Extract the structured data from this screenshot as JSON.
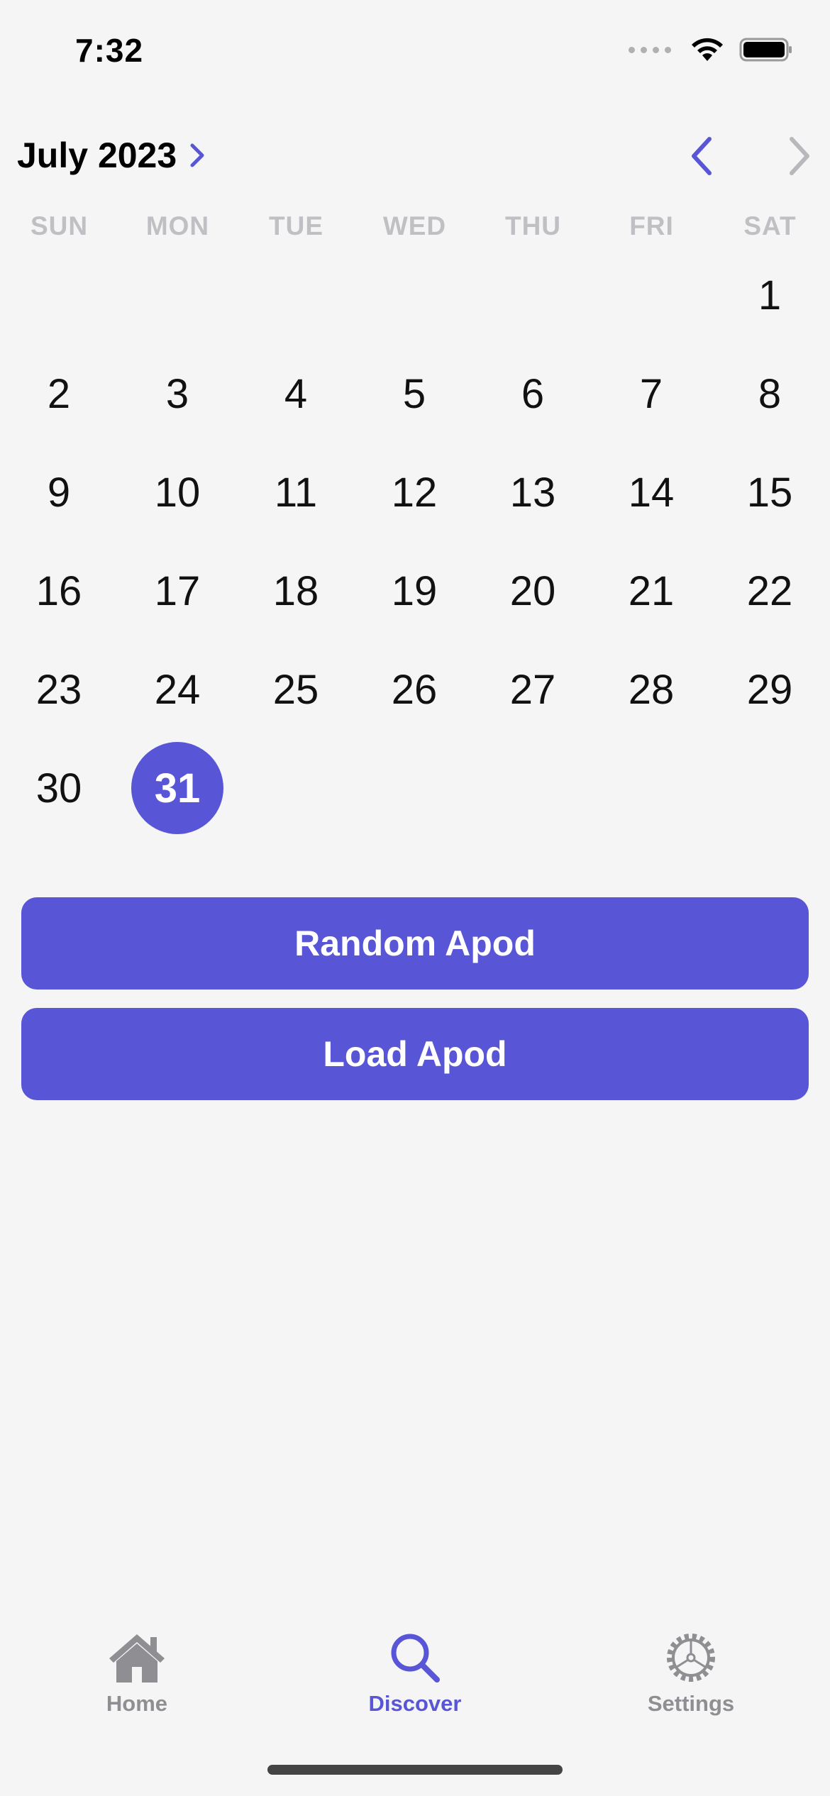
{
  "status_bar": {
    "time": "7:32"
  },
  "calendar": {
    "month_title": "July 2023",
    "weekdays": [
      "SUN",
      "MON",
      "TUE",
      "WED",
      "THU",
      "FRI",
      "SAT"
    ],
    "weeks": [
      [
        "",
        "",
        "",
        "",
        "",
        "",
        "1"
      ],
      [
        "2",
        "3",
        "4",
        "5",
        "6",
        "7",
        "8"
      ],
      [
        "9",
        "10",
        "11",
        "12",
        "13",
        "14",
        "15"
      ],
      [
        "16",
        "17",
        "18",
        "19",
        "20",
        "21",
        "22"
      ],
      [
        "23",
        "24",
        "25",
        "26",
        "27",
        "28",
        "29"
      ],
      [
        "30",
        "31",
        "",
        "",
        "",
        "",
        ""
      ]
    ],
    "selected_day": "31",
    "accent_color": "#5856d6"
  },
  "actions": {
    "random_label": "Random Apod",
    "load_label": "Load Apod"
  },
  "tab_bar": {
    "items": [
      {
        "label": "Home",
        "icon": "house-icon",
        "active": false
      },
      {
        "label": "Discover",
        "icon": "magnifyingglass-icon",
        "active": true
      },
      {
        "label": "Settings",
        "icon": "gear-icon",
        "active": false
      }
    ]
  }
}
